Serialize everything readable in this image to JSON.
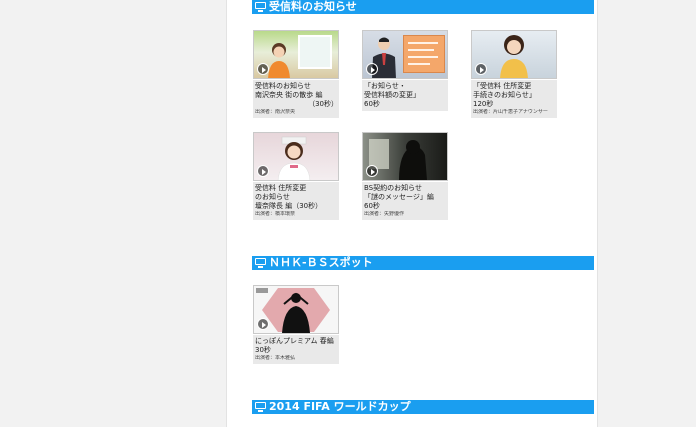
{
  "sections": [
    {
      "title": "受信料のお知らせ",
      "cards": [
        {
          "lines": [
            "受信料のお知らせ",
            "南沢奈央  街の散歩  編"
          ],
          "right_line": "（30秒）",
          "credit": "出演者：南沢奈央"
        },
        {
          "lines": [
            "「お知らせ・",
            "受信料額の変更」",
            "60秒"
          ],
          "credit": ""
        },
        {
          "lines": [
            "「受信料 住所変更",
            "  手続きのお知らせ」",
            "120秒"
          ],
          "credit": "出演者：片山千恵子アナウンサー"
        },
        {
          "lines": [
            "受信料 住所変更",
            "のお知らせ",
            "壇奈隊長 編（30秒）"
          ],
          "credit": "出演者：橋本環奈"
        },
        {
          "lines": [
            "BS契約のお知らせ",
            "「謎のメッセージ」編",
            "60秒"
          ],
          "credit": "出演者：矢野優作"
        }
      ]
    },
    {
      "title": "ＮＨＫ-ＢＳスポット",
      "cards": [
        {
          "lines": [
            "にっぽんプレミアム 春編",
            "30秒"
          ],
          "credit": "出演者：本木雅弘"
        }
      ]
    },
    {
      "title": "2014 FIFA ワールドカップ",
      "cards": []
    }
  ],
  "colors": {
    "header_bg": "#1a9ef0",
    "header_text": "#ffffff",
    "caption_bg": "#e9e9e9"
  },
  "icons": {
    "section_icon": "monitor-icon",
    "play": "play-icon"
  }
}
